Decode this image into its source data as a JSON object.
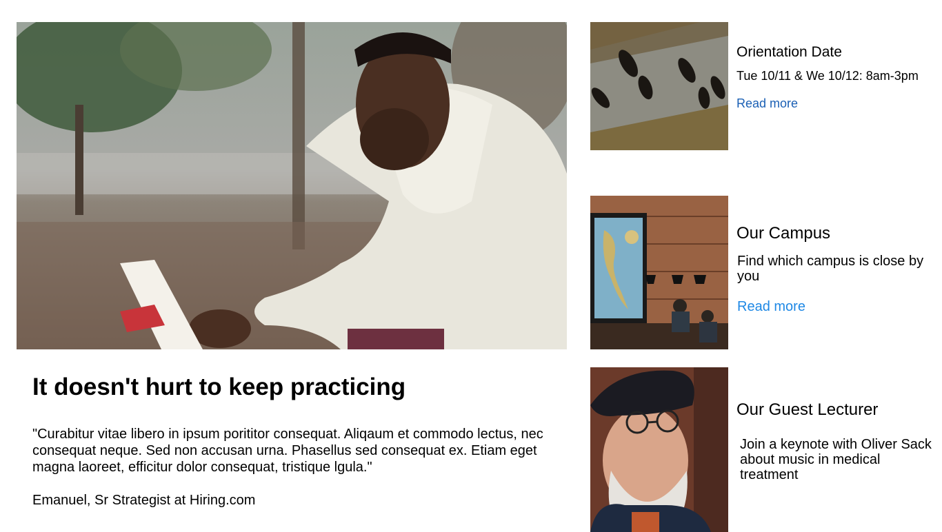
{
  "feature": {
    "image_alt": "Man reading a book outdoors",
    "headline": "It doesn't hurt to keep practicing",
    "quote": "\"Curabitur vitae libero in ipsum porititor consequat. Aliqaum et commodo lectus, nec consequat neque. Sed non accusan urna. Phasellus sed consequat ex. Etiam eget magna laoreet, efficitur dolor consequat, tristique lgula.\"",
    "attribution": "Emanuel, Sr Strategist at Hiring.com"
  },
  "cards": [
    {
      "title": "Orientation Date",
      "text": "Tue 10/11 & We 10/12: 8am-3pm",
      "link": "Read more"
    },
    {
      "title": "Our Campus",
      "text": "Find which campus is close by you",
      "link": "Read more"
    },
    {
      "title": "Our Guest Lecturer",
      "text": "Join a keynote with Oliver Sack about music in medical treatment"
    }
  ],
  "colors": {
    "link_primary": "#1a5fb4",
    "link_secondary": "#1e88e5"
  }
}
